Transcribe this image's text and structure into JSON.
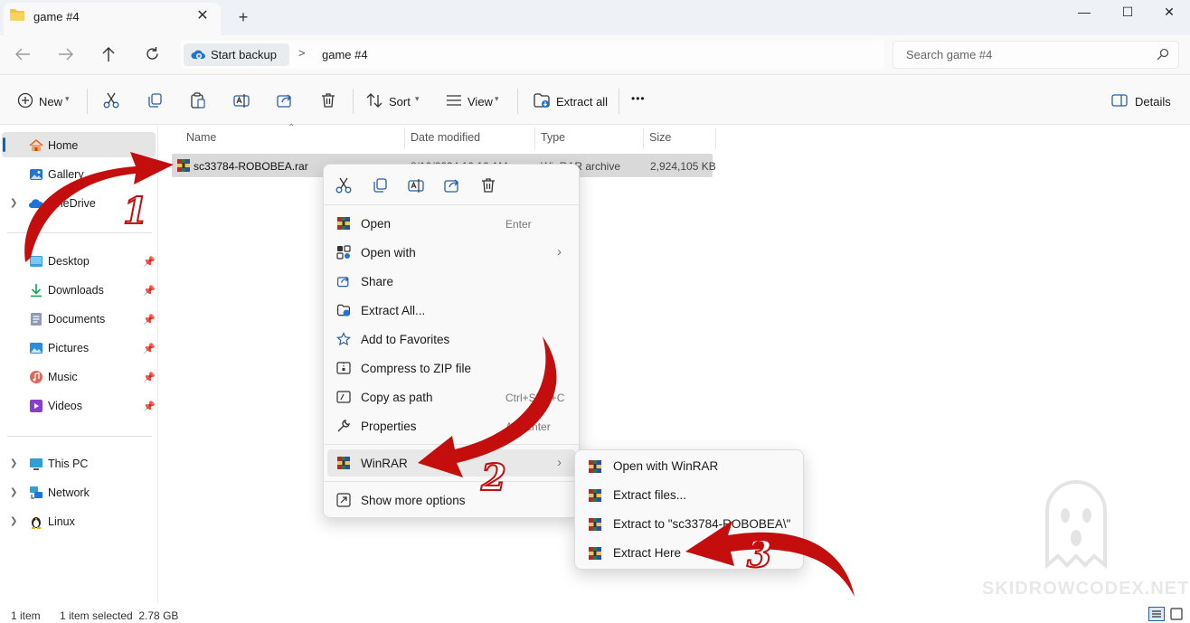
{
  "window": {
    "tab_title": "game #4",
    "close_tab": "✕",
    "new_tab": "+",
    "minimize": "—",
    "maximize": "☐",
    "close": "✕"
  },
  "address": {
    "backup_label": "Start backup",
    "separator": ">",
    "folder": "game #4",
    "search_placeholder": "Search game #4"
  },
  "toolbar": {
    "new_label": "New",
    "sort_label": "Sort",
    "view_label": "View",
    "extract_all_label": "Extract all",
    "more": "•••",
    "details_label": "Details"
  },
  "sidebar": {
    "items": [
      {
        "label": "Home"
      },
      {
        "label": "Gallery"
      },
      {
        "label": "OneDrive"
      },
      {
        "label": "Desktop"
      },
      {
        "label": "Downloads"
      },
      {
        "label": "Documents"
      },
      {
        "label": "Pictures"
      },
      {
        "label": "Music"
      },
      {
        "label": "Videos"
      },
      {
        "label": "This PC"
      },
      {
        "label": "Network"
      },
      {
        "label": "Linux"
      }
    ]
  },
  "file_list": {
    "columns": [
      "Name",
      "Date modified",
      "Type",
      "Size"
    ],
    "rows": [
      {
        "name": "sc33784-ROBOBEA.rar",
        "date": "8/10/2024 10:10 AM",
        "type": "WinRAR archive",
        "size": "2,924,105 KB"
      }
    ]
  },
  "context_menu": {
    "items": [
      {
        "label": "Open",
        "shortcut": "Enter"
      },
      {
        "label": "Open with",
        "shortcut": "›"
      },
      {
        "label": "Share",
        "shortcut": ""
      },
      {
        "label": "Extract All...",
        "shortcut": ""
      },
      {
        "label": "Add to Favorites",
        "shortcut": ""
      },
      {
        "label": "Compress to ZIP file",
        "shortcut": ""
      },
      {
        "label": "Copy as path",
        "shortcut": "Ctrl+Shift+C"
      },
      {
        "label": "Properties",
        "shortcut": "Alt+Enter"
      },
      {
        "label": "WinRAR",
        "shortcut": "›"
      },
      {
        "label": "Show more options",
        "shortcut": ""
      }
    ]
  },
  "submenu": {
    "items": [
      {
        "label": "Open with WinRAR"
      },
      {
        "label": "Extract files..."
      },
      {
        "label": "Extract to \"sc33784-ROBOBEA\\\""
      },
      {
        "label": "Extract Here"
      }
    ]
  },
  "annotations": {
    "step1": "1",
    "step2": "2",
    "step3": "3"
  },
  "status": {
    "count": "1 item",
    "selected": "1 item selected  2.78 GB"
  },
  "watermark": "SKIDROWCODEX.NET",
  "colors": {
    "accent": "#0067c0",
    "arrow": "#c30a0a",
    "selection": "#d9d9d9"
  }
}
